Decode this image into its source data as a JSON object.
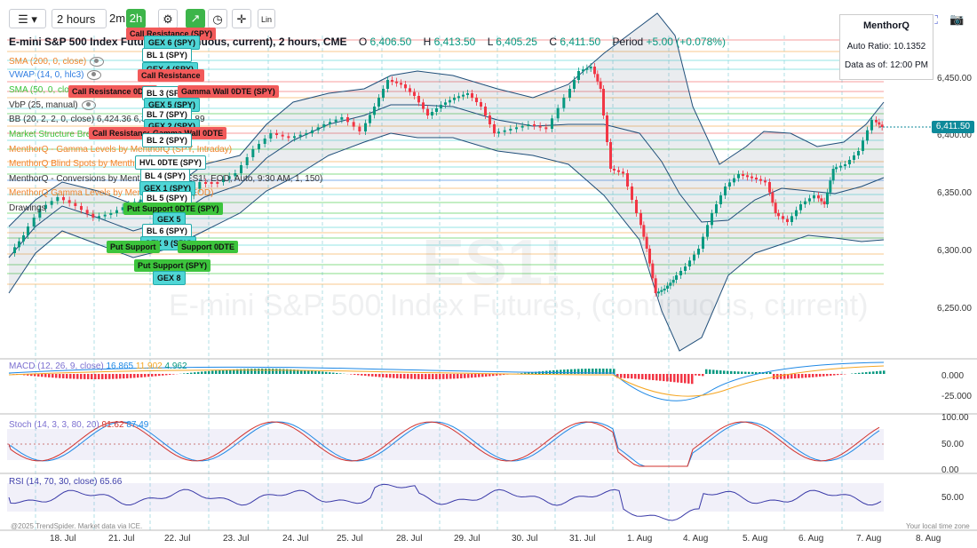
{
  "toolbar": {
    "interval": "2 hours",
    "quick1": "2m",
    "quick2": "2h",
    "lin": "Lin"
  },
  "header": {
    "symbol": "E-mini S&P 500 Index Futures, (continuous, current), 2 hours, CME",
    "o_label": "O",
    "o_val": "6,406.50",
    "h_label": "H",
    "h_val": "6,413.50",
    "l_label": "L",
    "l_val": "6,405.25",
    "c_label": "C",
    "c_val": "6,411.50",
    "period_label": "Period",
    "period_val": "+5.00 (+0.078%)"
  },
  "indicators": [
    {
      "text": "SMA (200, 0, close)",
      "color": "#f0832a"
    },
    {
      "text": "VWAP (14, 0, hlc3)",
      "color": "#2f7de1"
    },
    {
      "text": "SMA (50, 0, close)",
      "color": "#3cc43c"
    },
    {
      "text": "VbP (25, manual)",
      "color": "#333333"
    },
    {
      "text": "BB (20, 2, 2, 0, close)  6,424.36  6,368.13  6,311.89",
      "color": "#333333"
    },
    {
      "text": "Market Structure Breaks (0.1, 10, 20, 1.5, 20, 20, 20)",
      "color": "#3cc43c"
    },
    {
      "text": "MenthorQ - Gamma Levels by MenthorQ (SPY, Intraday)",
      "color": "#f0832a"
    },
    {
      "text": "MenthorQ Blind Spots by MenthorQ (SPY)",
      "color": "#f0832a"
    },
    {
      "text": "MenthorQ - Conversions by MenthorQ (SPY, ES1!, EOD, Auto, 9:30 AM, 1, 150)",
      "color": "#333333"
    },
    {
      "text": "MenthorQ Gamma Levels by MenthorQ (SPY, EOD)",
      "color": "#f0832a"
    },
    {
      "text": "Drawings",
      "color": "#333333"
    }
  ],
  "level_labels": [
    {
      "text": "Call Resistance (SPY)",
      "style": "red"
    },
    {
      "text": "GEX 6 (SPY)",
      "style": "cyan"
    },
    {
      "text": "BL 1 (SPY)",
      "style": "white"
    },
    {
      "text": "GEX 4 (SPY)",
      "style": "cyan"
    },
    {
      "text": "Call Resistance",
      "style": "red"
    },
    {
      "text": "Call Resistance 0DTE",
      "style": "red"
    },
    {
      "text": "BL 3 (SPY)",
      "style": "white"
    },
    {
      "text": "Gamma Wall 0DTE (SPY)",
      "style": "red"
    },
    {
      "text": "GEX 5 (SPY)",
      "style": "cyan"
    },
    {
      "text": "BL 7 (SPY)",
      "style": "white"
    },
    {
      "text": "GEX 2 (SPY)",
      "style": "cyan"
    },
    {
      "text": "Call Resistance",
      "style": "red"
    },
    {
      "text": "Gamma Wall 0DTE",
      "style": "red"
    },
    {
      "text": "BL 2 (SPY)",
      "style": "white"
    },
    {
      "text": "HVL 0DTE (SPY)",
      "style": "white"
    },
    {
      "text": "BL 4 (SPY)",
      "style": "white"
    },
    {
      "text": "GEX 1 (SPY)",
      "style": "cyan"
    },
    {
      "text": "BL 5 (SPY)",
      "style": "white"
    },
    {
      "text": "Put Support 0DTE (SPY)",
      "style": "green"
    },
    {
      "text": "GEX 5",
      "style": "cyan"
    },
    {
      "text": "BL 6 (SPY)",
      "style": "white"
    },
    {
      "text": "GEX 9 (SPY)",
      "style": "cyan"
    },
    {
      "text": "Put Support",
      "style": "green"
    },
    {
      "text": "Support 0DTE",
      "style": "green"
    },
    {
      "text": "Put Support (SPY)",
      "style": "green"
    },
    {
      "text": "GEX 8",
      "style": "cyan"
    }
  ],
  "info_box": {
    "title": "MenthorQ",
    "ratio_label": "Auto Ratio: 10.1352",
    "date_label": "Data as of: 12:00 PM"
  },
  "price_axis": {
    "ticks": [
      "6,450.00",
      "6,400.00",
      "6,350.00",
      "6,300.00",
      "6,250.00"
    ],
    "last_price": "6,411.50"
  },
  "macd": {
    "label": "MACD (12, 26, 9, close)",
    "v1": "16.865",
    "v2": "11.902",
    "v3": "4.962",
    "ticks": [
      "0.000",
      "-25.000"
    ]
  },
  "stoch": {
    "label": "Stoch (14, 3, 3, 80, 20)",
    "v1": "91.62",
    "v2": "87.49",
    "ticks": [
      "100.00",
      "50.00",
      "0.00"
    ]
  },
  "rsi": {
    "label": "RSI (14, 70, 30, close)",
    "v1": "65.66",
    "ticks": [
      "50.00"
    ]
  },
  "dates": [
    "18. Jul",
    "21. Jul",
    "22. Jul",
    "23. Jul",
    "24. Jul",
    "25. Jul",
    "28. Jul",
    "29. Jul",
    "30. Jul",
    "31. Jul",
    "1. Aug",
    "4. Aug",
    "5. Aug",
    "6. Aug",
    "7. Aug",
    "8. Aug"
  ],
  "watermark": {
    "symbol": "ES1!",
    "name": "E-mini S&P 500 Index Futures, (continuous, current)"
  },
  "footer": {
    "copyright": "@2025 TrendSpider. Market data via ICE.",
    "tz": "Your local time zone"
  },
  "colors": {
    "up": "#089981",
    "down": "#f23645",
    "bb": "#1f4e79",
    "accent": "#3db54a"
  }
}
